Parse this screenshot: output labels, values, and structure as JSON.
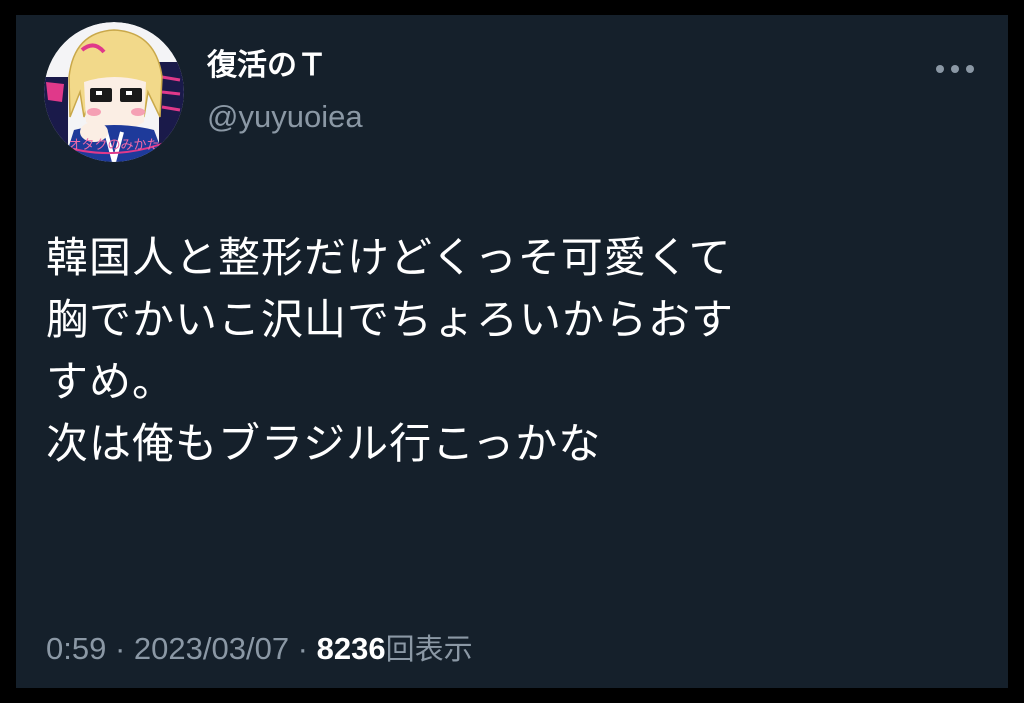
{
  "author": {
    "display_name": "復活のＴ",
    "handle": "@yuyuoiea",
    "avatar_text": [
      "オタクのみかた"
    ]
  },
  "tweet": {
    "lines": [
      "韓国人と整形だけどくっそ可愛くて",
      "胸でかいこ沢山でちょろいからおす",
      "すめ。",
      "次は俺もブラジル行こっかな"
    ]
  },
  "meta": {
    "time": "0:59",
    "separator": " · ",
    "date": "2023/03/07",
    "views_count": "8236",
    "views_label": "回表示"
  },
  "icons": {
    "more": "more-horizontal-icon"
  },
  "colors": {
    "background": "#15202b",
    "outer": "#000000",
    "text": "#ffffff",
    "secondary": "#8b98a5"
  }
}
